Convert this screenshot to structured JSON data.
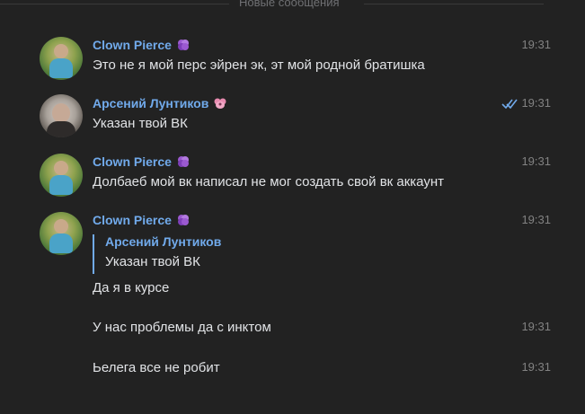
{
  "divider_label": "Новые сообщения",
  "messages": [
    {
      "author": "Clown Pierce",
      "time": "19:31",
      "text": "Это не я мой перс эйрен эк, эт мой родной братишка"
    },
    {
      "author": "Арсений Лунтиков",
      "time": "19:31",
      "text": "Указан твой ВК"
    },
    {
      "author": "Clown Pierce",
      "time": "19:31",
      "text": "Долбаеб мой вк написал не мог создать свой вк аккаунт"
    },
    {
      "author": "Clown Pierce",
      "time": "19:31",
      "reply": {
        "author": "Арсений Лунтиков",
        "text": "Указан твой ВК"
      },
      "text": "Да я в курсе"
    }
  ],
  "followups": [
    {
      "text": "У нас проблемы да с инктом",
      "time": "19:31"
    },
    {
      "text": "Ьелега все не робит",
      "time": "19:31"
    }
  ],
  "colors": {
    "background": "#222222",
    "author": "#71aaeb",
    "text": "#e1e3e6",
    "time": "#828282"
  },
  "icons": {
    "clown_badge": "purple-clover-badge-icon",
    "arseniy_badge": "pink-flower-badge-icon",
    "read": "double-check-icon"
  }
}
